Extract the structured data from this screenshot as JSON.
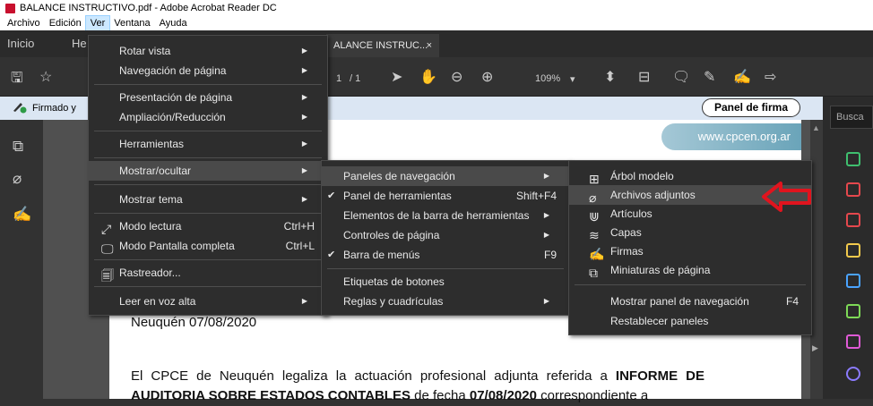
{
  "window": {
    "title": "BALANCE INSTRUCTIVO.pdf - Adobe Acrobat Reader DC"
  },
  "menubar": [
    "Archivo",
    "Edición",
    "Ver",
    "Ventana",
    "Ayuda"
  ],
  "tabs": {
    "home": "Inicio",
    "tools": "He",
    "document": "ALANCE INSTRUC...",
    "close": "×"
  },
  "toolbar": {
    "page_current": "1",
    "page_total": "/ 1",
    "zoom": "109%"
  },
  "signbar": {
    "text": "Firmado y",
    "panel_button": "Panel de firma"
  },
  "right_panel": {
    "search": "Busca"
  },
  "document": {
    "url": "www.cpcen.org.ar",
    "date": "Neuquén 07/08/2020",
    "body_1": "El CPCE de Neuquén legaliza la actuación profesional adjunta referida a ",
    "body_bold_1": "INFORME DE AUDITORIA SOBRE ESTADOS CONTABLES",
    "body_2": " de fecha ",
    "body_bold_2": "07/08/2020",
    "body_3": " correspondiente a"
  },
  "menu_ver": [
    {
      "label": "Rotar vista",
      "submenu": true
    },
    {
      "label": "Navegación de página",
      "submenu": true
    },
    {
      "label": "Presentación de página",
      "submenu": true
    },
    {
      "label": "Ampliación/Reducción",
      "submenu": true
    },
    {
      "label": "Herramientas",
      "submenu": true
    },
    {
      "label": "Mostrar/ocultar",
      "submenu": true,
      "highlighted": true
    },
    {
      "label": "Mostrar tema",
      "submenu": true
    },
    {
      "label": "Modo lectura",
      "shortcut": "Ctrl+H",
      "icon": "expand-icon"
    },
    {
      "label": "Modo Pantalla completa",
      "shortcut": "Ctrl+L",
      "icon": "monitor-icon"
    },
    {
      "label": "Rastreador...",
      "icon": "tracker-icon"
    },
    {
      "label": "Leer en voz alta",
      "submenu": true
    }
  ],
  "menu_mostrar": [
    {
      "label": "Paneles de navegación",
      "submenu": true,
      "highlighted": true
    },
    {
      "label": "Panel de herramientas",
      "shortcut": "Shift+F4",
      "checked": true
    },
    {
      "label": "Elementos de la barra de herramientas",
      "submenu": true
    },
    {
      "label": "Controles de página",
      "submenu": true
    },
    {
      "label": "Barra de menús",
      "shortcut": "F9",
      "checked": true
    },
    {
      "label": "Etiquetas de botones"
    },
    {
      "label": "Reglas y cuadrículas",
      "submenu": true
    }
  ],
  "menu_paneles": [
    {
      "label": "Árbol modelo",
      "icon": "model-tree-icon"
    },
    {
      "label": "Archivos adjuntos",
      "icon": "paperclip-icon",
      "highlighted": true
    },
    {
      "label": "Artículos",
      "icon": "articles-icon"
    },
    {
      "label": "Capas",
      "icon": "layers-icon"
    },
    {
      "label": "Firmas",
      "icon": "signature-icon"
    },
    {
      "label": "Miniaturas de página",
      "icon": "thumbnails-icon"
    },
    {
      "label": "Mostrar panel de navegación",
      "shortcut": "F4"
    },
    {
      "label": "Restablecer paneles"
    }
  ],
  "colors": {
    "highlight": "#4a4a4a",
    "menu_bg": "#2d2d2d",
    "arrow": "#e0141e",
    "signbar": "#dbe6f3"
  }
}
